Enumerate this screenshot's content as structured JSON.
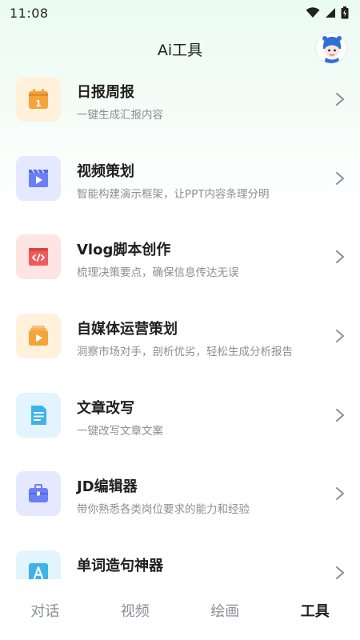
{
  "status": {
    "time": "11:08"
  },
  "header": {
    "title": "Ai工具"
  },
  "tools": [
    {
      "title": "日报周报",
      "desc": "一键生成汇报内容",
      "icon": "calendar-icon",
      "bg": "#fff1dc",
      "fg": "#f4a43a"
    },
    {
      "title": "视频策划",
      "desc": "智能构建演示框架，让PPT内容条理分明",
      "icon": "video-clapper-icon",
      "bg": "#e4e9ff",
      "fg": "#6b7ef5"
    },
    {
      "title": "Vlog脚本创作",
      "desc": "梳理决策要点，确保信息传达无误",
      "icon": "code-window-icon",
      "bg": "#ffe4e4",
      "fg": "#ef5a5a"
    },
    {
      "title": "自媒体运营策划",
      "desc": "洞察市场对手，剖析优劣，轻松生成分析报告",
      "icon": "play-stack-icon",
      "bg": "#fff1dc",
      "fg": "#f4a43a"
    },
    {
      "title": "文章改写",
      "desc": "一键改写文章文案",
      "icon": "document-icon",
      "bg": "#e2f4fd",
      "fg": "#3fb2ea"
    },
    {
      "title": "JD编辑器",
      "desc": "带你熟悉各类岗位要求的能力和经验",
      "icon": "briefcase-icon",
      "bg": "#e4e9ff",
      "fg": "#6b7ef5"
    },
    {
      "title": "单词造句神器",
      "desc": "",
      "icon": "letter-a-icon",
      "bg": "#e2f4fd",
      "fg": "#3fb2ea"
    }
  ],
  "tabbar": {
    "tabs": [
      {
        "label": "对话",
        "active": false
      },
      {
        "label": "视频",
        "active": false
      },
      {
        "label": "绘画",
        "active": false
      },
      {
        "label": "工具",
        "active": true
      }
    ]
  }
}
